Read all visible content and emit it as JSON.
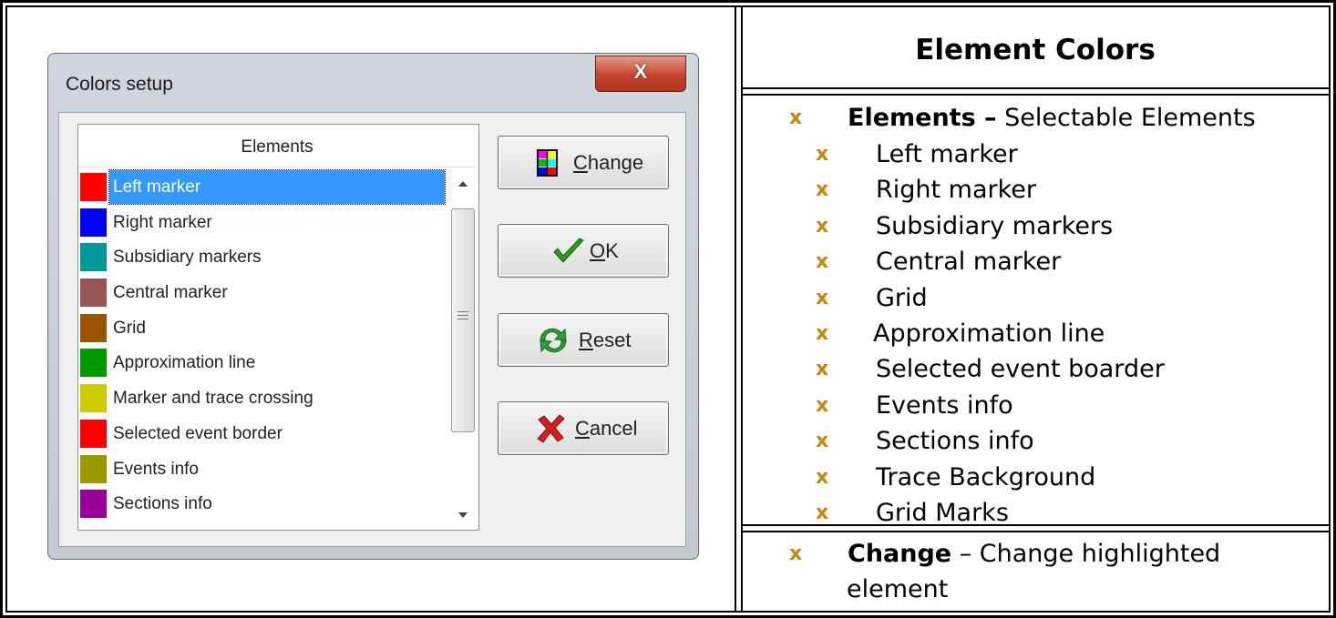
{
  "dialog": {
    "title": "Colors setup",
    "close_label": "X",
    "list_header": "Elements",
    "items": [
      {
        "label": "Left marker",
        "color": "#ff0000",
        "selected": true
      },
      {
        "label": "Right marker",
        "color": "#0000ff"
      },
      {
        "label": "Subsidiary markers",
        "color": "#009999"
      },
      {
        "label": "Central marker",
        "color": "#995555"
      },
      {
        "label": "Grid",
        "color": "#995500"
      },
      {
        "label": "Approximation line",
        "color": "#009900"
      },
      {
        "label": "Marker and trace crossing",
        "color": "#cccc00"
      },
      {
        "label": "Selected event border",
        "color": "#ff0000"
      },
      {
        "label": "Events info",
        "color": "#999900"
      },
      {
        "label": "Sections info",
        "color": "#990099"
      }
    ],
    "buttons": {
      "change_u": "C",
      "change_rest": "hange",
      "ok_u": "O",
      "ok_rest": "K",
      "reset_u": "R",
      "reset_rest": "eset",
      "cancel_u": "C",
      "cancel_rest": "ancel"
    }
  },
  "doc": {
    "heading": "Element Colors",
    "bullet_glyph": "x",
    "elements_title": "Elements –",
    "elements_desc": " Selectable Elements",
    "element_list": [
      "Left marker",
      "Right marker",
      "Subsidiary markers",
      "Central marker",
      "Grid",
      "Approximation line",
      "Selected event boarder",
      "Events info",
      "Sections info",
      "Trace Background",
      "Grid Marks"
    ],
    "change_title": "Change",
    "change_desc_line1": " – Change highlighted",
    "change_desc_line2": "element"
  }
}
